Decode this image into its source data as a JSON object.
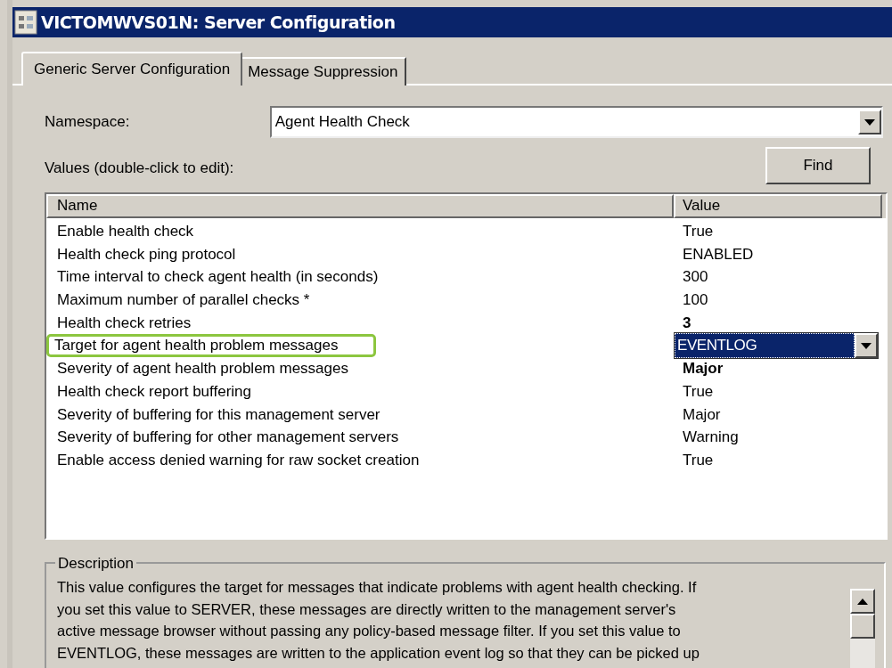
{
  "window": {
    "title": "VICTOMWVS01N: Server Configuration"
  },
  "tabs": [
    {
      "label": "Generic Server Configuration",
      "selected": true
    },
    {
      "label": "Message Suppression",
      "selected": false
    }
  ],
  "namespace": {
    "label": "Namespace:",
    "value": "Agent Health Check"
  },
  "values_label": "Values (double-click to edit):",
  "find_button": "Find",
  "table": {
    "columns": [
      "Name",
      "Value"
    ],
    "rows": [
      {
        "name": "Enable health check",
        "value": "True",
        "kind": "text",
        "highlighted": false
      },
      {
        "name": "Health check ping protocol",
        "value": "ENABLED",
        "kind": "text",
        "highlighted": false
      },
      {
        "name": "Time interval to check agent health (in seconds)",
        "value": "300",
        "kind": "text",
        "highlighted": false
      },
      {
        "name": "Maximum number of parallel checks *",
        "value": "100",
        "kind": "text",
        "highlighted": false
      },
      {
        "name": "Health check retries",
        "value": "3",
        "kind": "bold",
        "highlighted": false
      },
      {
        "name": "Target for agent health problem messages",
        "value": "EVENTLOG",
        "kind": "dropdown",
        "highlighted": true
      },
      {
        "name": "Severity of agent health problem messages",
        "value": "Major",
        "kind": "bold",
        "highlighted": false
      },
      {
        "name": "Health check report buffering",
        "value": "True",
        "kind": "text",
        "highlighted": false
      },
      {
        "name": "Severity of buffering for this management server",
        "value": "Major",
        "kind": "text",
        "highlighted": false
      },
      {
        "name": "Severity of buffering for other management servers",
        "value": "Warning",
        "kind": "text",
        "highlighted": false
      },
      {
        "name": "Enable access denied warning for raw socket creation",
        "value": "True",
        "kind": "text",
        "highlighted": false
      }
    ]
  },
  "description": {
    "title": "Description",
    "lines": [
      "This value configures the target for messages that indicate problems with agent health checking. If",
      "you set this value to SERVER, these messages are directly written to the management server's",
      "active message browser without passing any policy-based message filter. If you set this value to",
      "EVENTLOG, these messages are written to the application event log so that they can be picked up"
    ]
  }
}
